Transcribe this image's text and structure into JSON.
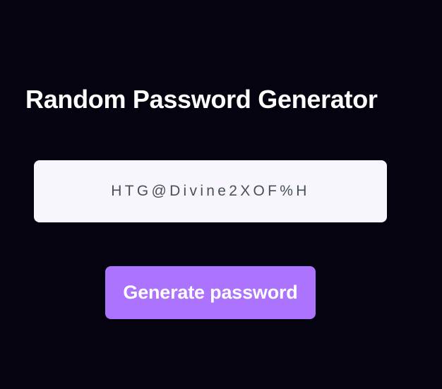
{
  "app": {
    "title": "Random Password Generator"
  },
  "password_field": {
    "value": "HTG@Divine2XOF%H"
  },
  "generate_button": {
    "label": "Generate password"
  },
  "colors": {
    "background": "#060310",
    "title_text": "#ffffff",
    "field_background": "#f8f6fd",
    "field_text": "#48505a",
    "button_background": "#ac73ff",
    "button_text": "#ffffff"
  }
}
